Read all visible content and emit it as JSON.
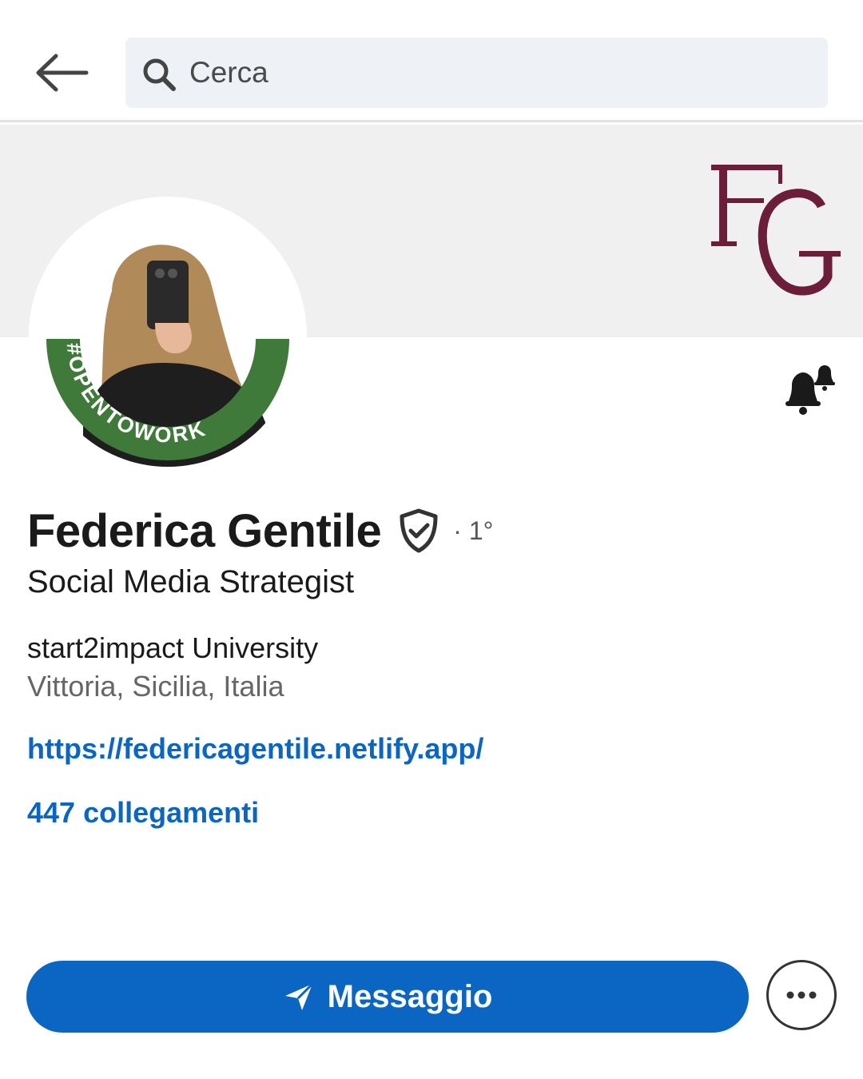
{
  "search": {
    "placeholder": "Cerca"
  },
  "banner": {
    "logo_text": "FG",
    "logo_color": "#6b1d3a"
  },
  "avatar": {
    "badge_text": "#OPENTOWORK",
    "badge_color": "#3f7a3a"
  },
  "profile": {
    "name": "Federica Gentile",
    "degree": "· 1°",
    "headline": "Social Media Strategist",
    "organization": "start2impact University",
    "location": "Vittoria, Sicilia, Italia",
    "website": "https://federicagentile.netlify.app/",
    "connections": "447 collegamenti"
  },
  "actions": {
    "message_label": "Messaggio",
    "more_label": "•••"
  },
  "colors": {
    "accent": "#0a66c2",
    "search_bg": "#eef2f7",
    "banner_bg": "#f0f0f0"
  },
  "icons": [
    "back-arrow-icon",
    "search-icon",
    "bell-icon",
    "verified-shield-icon",
    "send-icon",
    "more-icon"
  ]
}
